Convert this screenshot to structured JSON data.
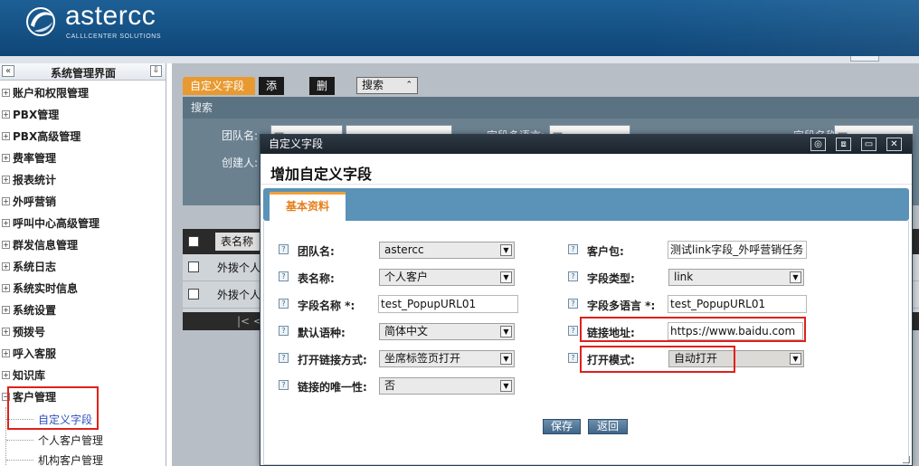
{
  "brand": {
    "name": "astercc",
    "tagline": "CALLLCENTER SOLUTIONS"
  },
  "sidebar": {
    "title": "系统管理界面",
    "items": [
      {
        "label": "账户和权限管理"
      },
      {
        "label": "PBX管理"
      },
      {
        "label": "PBX高级管理"
      },
      {
        "label": "费率管理"
      },
      {
        "label": "报表统计"
      },
      {
        "label": "外呼营销"
      },
      {
        "label": "呼叫中心高级管理"
      },
      {
        "label": "群发信息管理"
      },
      {
        "label": "系统日志"
      },
      {
        "label": "系统实时信息"
      },
      {
        "label": "系统设置"
      },
      {
        "label": "预拨号"
      },
      {
        "label": "呼入客服"
      },
      {
        "label": "知识库"
      },
      {
        "label": "客户管理"
      }
    ],
    "subitems": [
      {
        "label": "自定义字段"
      },
      {
        "label": "个人客户管理"
      },
      {
        "label": "机构客户管理"
      }
    ]
  },
  "toolbar": {
    "tab_active": "自定义字段",
    "add": "添加",
    "delete": "删除",
    "search": "搜索"
  },
  "searchpanel": {
    "header": "搜索",
    "team_label": "团队名:",
    "team_value": "—",
    "creator_label": "创建人:",
    "lang_label": "字段多语言:",
    "lang_value": "—",
    "fname_label": "字段名称:",
    "fname_value": "—"
  },
  "grid": {
    "col": "表名称",
    "rows": [
      "外拨个人客",
      "外拨个人客"
    ],
    "pager": "|<  <"
  },
  "dialog": {
    "title": "自定义字段",
    "heading": "增加自定义字段",
    "tab": "基本资料",
    "left": [
      {
        "label": "团队名:",
        "type": "select",
        "value": "astercc"
      },
      {
        "label": "表名称:",
        "type": "select",
        "value": "个人客户"
      },
      {
        "label": "字段名称 *:",
        "type": "input",
        "value": "test_PopupURL01"
      },
      {
        "label": "默认语种:",
        "type": "select",
        "value": "简体中文"
      },
      {
        "label": "打开链接方式:",
        "type": "select",
        "value": "坐席标签页打开"
      },
      {
        "label": "链接的唯一性:",
        "type": "select",
        "value": "否"
      }
    ],
    "right": [
      {
        "label": "客户包:",
        "type": "input",
        "value": "测试link字段_外呼营销任务"
      },
      {
        "label": "字段类型:",
        "type": "select",
        "value": "link"
      },
      {
        "label": "字段多语言 *:",
        "type": "input",
        "value": "test_PopupURL01"
      },
      {
        "label": "链接地址:",
        "type": "input",
        "value": "https://www.baidu.com"
      },
      {
        "label": "打开模式:",
        "type": "select",
        "value": "自动打开"
      }
    ],
    "save": "保存",
    "back": "返回"
  },
  "colors": {
    "accent": "#e89a30",
    "header": "#1d5f95",
    "highlight": "#e0201b",
    "link": "#2b4ec2"
  }
}
